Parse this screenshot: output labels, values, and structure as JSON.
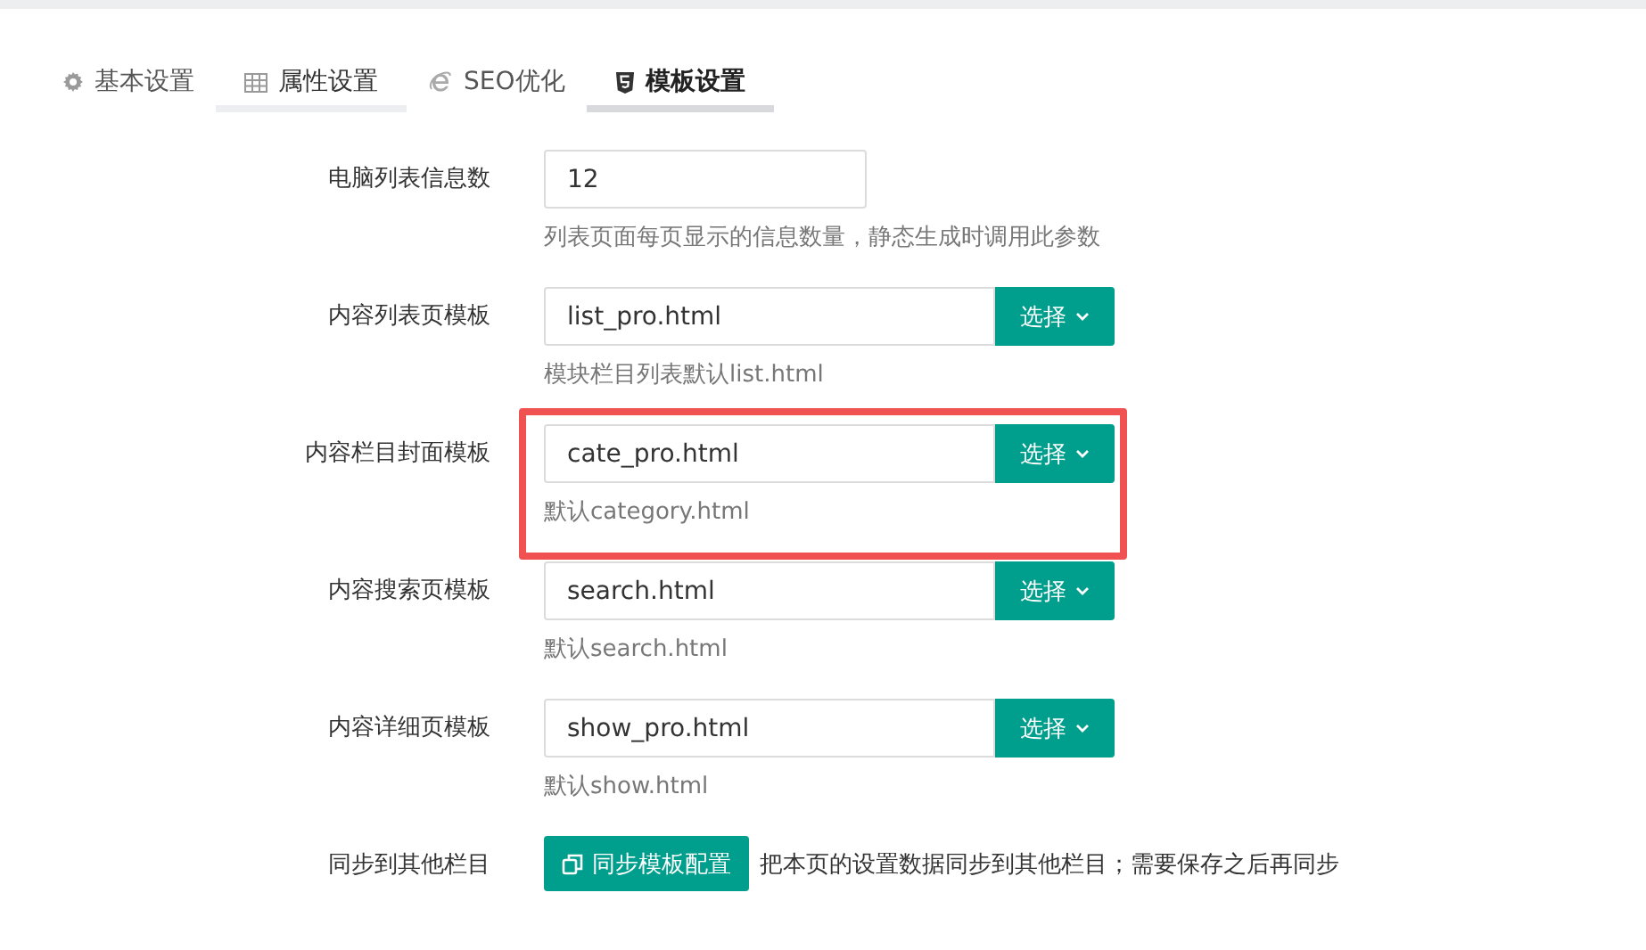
{
  "tabs": [
    {
      "label": "基本设置",
      "selected": false,
      "hovered": false
    },
    {
      "label": "属性设置",
      "selected": false,
      "hovered": true
    },
    {
      "label": "SEO优化",
      "selected": false,
      "hovered": false
    },
    {
      "label": "模板设置",
      "selected": true,
      "hovered": false
    }
  ],
  "rows": [
    {
      "kind": "number",
      "label": "电脑列表信息数",
      "value": "12",
      "help": "列表页面每页显示的信息数量，静态生成时调用此参数",
      "highlighted": false
    },
    {
      "kind": "template",
      "label": "内容列表页模板",
      "value": "list_pro.html",
      "button": "选择",
      "help": "模块栏目列表默认list.html",
      "highlighted": false
    },
    {
      "kind": "template",
      "label": "内容栏目封面模板",
      "value": "cate_pro.html",
      "button": "选择",
      "help": "默认category.html",
      "highlighted": true
    },
    {
      "kind": "template",
      "label": "内容搜索页模板",
      "value": "search.html",
      "button": "选择",
      "help": "默认search.html",
      "highlighted": false
    },
    {
      "kind": "template",
      "label": "内容详细页模板",
      "value": "show_pro.html",
      "button": "选择",
      "help": "默认show.html",
      "highlighted": false
    },
    {
      "kind": "sync",
      "label": "同步到其他栏目",
      "button": "同步模板配置",
      "help": "把本页的设置数据同步到其他栏目；需要保存之后再同步",
      "highlighted": false
    }
  ]
}
